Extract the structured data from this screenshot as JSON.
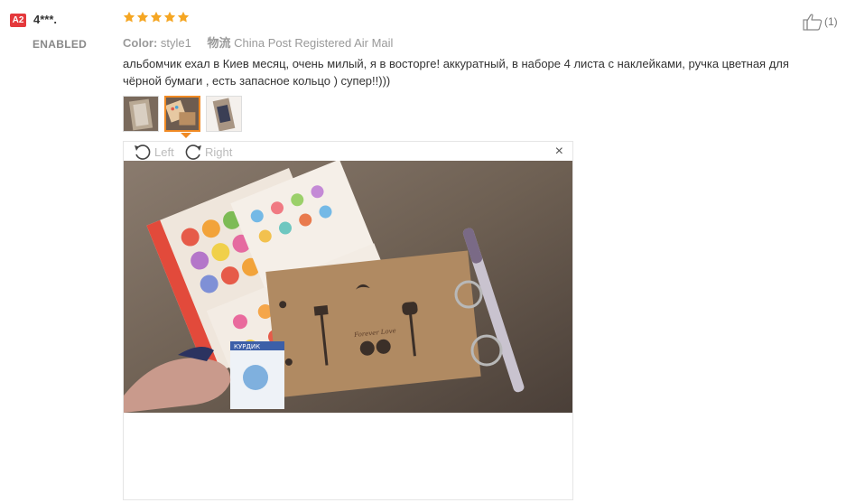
{
  "reviewer": {
    "badge": "A2",
    "name": "4***.",
    "country": "ENABLED"
  },
  "rating": {
    "stars": 5,
    "max": 5,
    "color": "#f5a623"
  },
  "meta": {
    "color_label": "Color:",
    "color_value": "style1",
    "shipping_label": "物流",
    "shipping_value": "China Post Registered Air Mail"
  },
  "helpful": {
    "icon": "thumbs-up-icon",
    "count": "(1)"
  },
  "review_text": "альбомчик ехал в Киев месяц, очень милый, я в восторге! аккуратный, в наборе 4 листа с наклейками, ручка цветная для чёрной бумаги , есть запасное кольцо ) супер!!)))",
  "thumbnails": [
    {
      "name": "photo-1",
      "active": false
    },
    {
      "name": "photo-2",
      "active": true
    },
    {
      "name": "photo-3",
      "active": false
    }
  ],
  "viewer": {
    "rotate_left": "Left",
    "rotate_right": "Right",
    "close": "×"
  },
  "photo_text": {
    "book": "Forever Love",
    "tag": "КУРДИК"
  },
  "colors": {
    "accent": "#f08a24",
    "badge": "#e4393c"
  }
}
